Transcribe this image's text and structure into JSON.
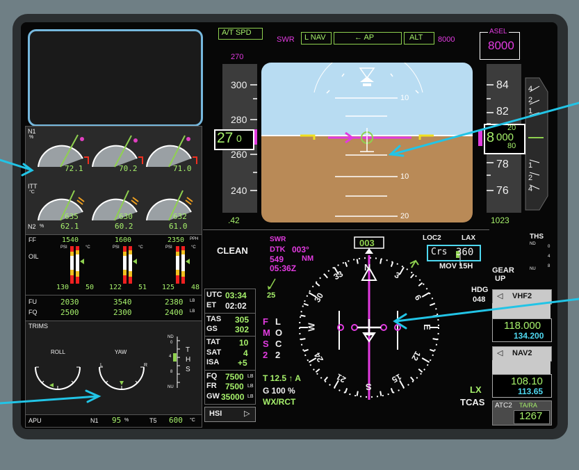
{
  "eicas": {
    "n1_label": "N1",
    "n1_unit": "%",
    "n1_values": [
      "72.1",
      "70.2",
      "71.0"
    ],
    "itt_label": "ITT",
    "itt_unit": "°C",
    "itt_values": [
      "635",
      "630",
      "632"
    ],
    "n2_label": "N2",
    "n2_unit": "%",
    "n2_values": [
      "62.1",
      "60.2",
      "61.0"
    ],
    "ff_label": "FF",
    "ff_values": [
      "1540",
      "1600",
      "2350"
    ],
    "ff_unit": "PPH",
    "oil_label": "OIL",
    "psi_label": "PSI",
    "degc_label": "°C",
    "oil_values": [
      [
        "130",
        "50"
      ],
      [
        "122",
        "51"
      ],
      [
        "125",
        "48"
      ]
    ],
    "fu_label": "FU",
    "fu_values": [
      "2030",
      "3540",
      "2380"
    ],
    "fq_label": "FQ",
    "fq_values": [
      "2500",
      "2300",
      "2400"
    ],
    "lb_unit": "LB",
    "trims_label": "TRIMS",
    "roll_label": "ROLL",
    "yaw_label": "YAW",
    "yaw_l": "L",
    "yaw_r": "R",
    "trim_nd": "ND",
    "trim_nu": "NU",
    "ths_letters": [
      "T",
      "H",
      "S"
    ],
    "trim_scale": [
      "0",
      "4",
      "8"
    ],
    "apu_label": "APU",
    "apu_n1_label": "N1",
    "apu_n1_value": "95",
    "apu_n1_unit": "%",
    "apu_t5_label": "T5",
    "apu_t5_value": "600",
    "apu_t5_unit": "°C"
  },
  "pfd": {
    "at_mode": "A/T SPD",
    "swr": "SWR",
    "lat_mode": "L NAV",
    "ap": "← AP",
    "vert_mode": "ALT",
    "alt_target": "8000",
    "asel_label": "ASEL",
    "asel_value": "8000",
    "speed_bug": "270",
    "speed_ticks": [
      "300",
      "280",
      "260",
      "240"
    ],
    "speed_current": "27",
    "speed_current_small": "0",
    "mach": ".42",
    "alt_ticks": [
      "84",
      "82",
      "78",
      "76"
    ],
    "alt_current_big": "8",
    "alt_current_small": "000",
    "alt_above": "20",
    "alt_below": "80",
    "baro": "1023",
    "vs_ticks": [
      "4",
      "2",
      "1",
      "1",
      "2",
      "4"
    ],
    "pitch_labels": [
      "10",
      "10",
      "20"
    ]
  },
  "mfd": {
    "config": "CLEAN",
    "swr": "SWR",
    "dtk_label": "DTK",
    "dtk_value": "003°",
    "dist_value": "549",
    "dist_unit": "NM",
    "ete": "05:36Z",
    "heading": "003",
    "loc_label": "LOC2",
    "loc_dest": "LAX",
    "crs_label": "Crs",
    "crs_value": "360",
    "mov_label": "MOV 15H",
    "gear_label": "GEAR",
    "gear_state": "UP",
    "hdg_label": "HDG",
    "hdg_value": "048",
    "ths_label": "THS",
    "ths_scale": [
      "ND",
      "0",
      "4",
      "8",
      "NU"
    ],
    "wind_speed": "25",
    "utc_label": "UTC",
    "utc_value": "03:34",
    "et_label": "ET",
    "et_value": "02:02",
    "tas_label": "TAS",
    "tas_value": "305",
    "gs_label": "GS",
    "gs_value": "302",
    "tat_label": "TAT",
    "tat_value": "10",
    "sat_label": "SAT",
    "sat_value": "4",
    "isa_label": "ISA",
    "isa_value": "+5",
    "fq_label": "FQ",
    "fq_value": "7500",
    "fr_label": "FR",
    "fr_value": "7500",
    "gw_label": "GW",
    "gw_value": "35000",
    "lb_unit": "LB",
    "hsi_button": "HSI",
    "fms_letters": [
      "F",
      "M",
      "S",
      "2"
    ],
    "loc_letters": [
      "L",
      "O",
      "C",
      "2"
    ],
    "temp_line": "T 12.5 ↑ A",
    "gain_line": "G 100 %",
    "wx_line": "WX/RCT",
    "lx": "LX",
    "tcas": "TCAS",
    "compass_labels": [
      "N",
      "3",
      "6",
      "E",
      "12",
      "15",
      "S",
      "21",
      "24",
      "W",
      "30",
      "33"
    ]
  },
  "radio": {
    "vhf_label": "VHF2",
    "vhf_active": "118.000",
    "vhf_standby": "134.200",
    "nav_label": "NAV2",
    "nav_active": "108.10",
    "nav_standby": "113.65",
    "atc_label": "ATC2",
    "atc_mode": "TA/RA",
    "atc_code": "1267"
  },
  "colors": {
    "green": "#a6f06b",
    "magenta": "#e23be0",
    "cyan": "#4fd8f0",
    "sky": "#b8dcf2",
    "ground": "#b98a57",
    "pointer": "#22c4e6"
  }
}
